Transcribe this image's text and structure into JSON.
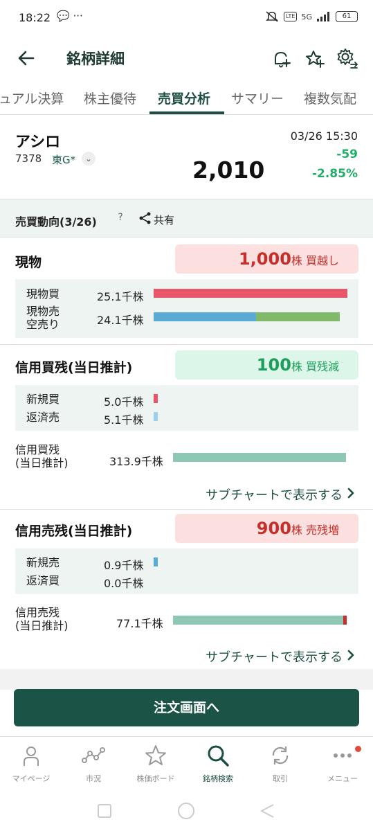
{
  "status_bar": {
    "time": "18:22",
    "left_icons": "💬 ···",
    "network": "5G",
    "battery": "61"
  },
  "header": {
    "title": "銘柄詳細"
  },
  "tabs": [
    {
      "label": "ュアル決算"
    },
    {
      "label": "株主優待"
    },
    {
      "label": "売買分析",
      "active": true
    },
    {
      "label": "サマリー"
    },
    {
      "label": "複数気配"
    }
  ],
  "stock": {
    "name": "アシロ",
    "code": "7378",
    "market": "東G*",
    "price": "2,010",
    "datetime": "03/26 15:30",
    "change": "-59",
    "change_pct": "-2.85%"
  },
  "section": {
    "title": "売買動向(3/26)",
    "help": "?",
    "share_label": "共有"
  },
  "spot": {
    "title": "現物",
    "badge_num": "1,000",
    "badge_unit": "株 買越し",
    "rows": [
      {
        "label": "現物買",
        "value": "25.1千株"
      },
      {
        "label": "現物売\n空売り",
        "value": "24.1千株"
      }
    ],
    "buy_fraction": 1.0,
    "sell_fraction": 0.96,
    "short_share": 0.45
  },
  "margin_buy": {
    "title": "信用買残(当日推計)",
    "badge_num": "100",
    "badge_unit": "株 買残減",
    "rows": [
      {
        "label": "新規買",
        "value": "5.0千株"
      },
      {
        "label": "返済売",
        "value": "5.1千株"
      }
    ],
    "balance_label": "信用買残\n(当日推計)",
    "balance_value": "313.9千株",
    "sub_chart_link": "サブチャートで表示する"
  },
  "margin_sell": {
    "title": "信用売残(当日推計)",
    "badge_num": "900",
    "badge_unit": "株 売残増",
    "rows": [
      {
        "label": "新規売",
        "value": "0.9千株"
      },
      {
        "label": "返済買",
        "value": "0.0千株"
      }
    ],
    "balance_label": "信用売残\n(当日推計)",
    "balance_value": "77.1千株",
    "sub_chart_link": "サブチャートで表示する"
  },
  "order_button": {
    "label": "注文画面へ"
  },
  "bottom_nav": [
    {
      "label": "マイページ",
      "icon": "person-icon"
    },
    {
      "label": "市況",
      "icon": "market-icon"
    },
    {
      "label": "株価ボード",
      "icon": "star-icon"
    },
    {
      "label": "銘柄検索",
      "icon": "search-icon",
      "active": true
    },
    {
      "label": "取引",
      "icon": "trade-icon"
    },
    {
      "label": "メニュー",
      "icon": "menu-icon"
    }
  ],
  "colors": {
    "accent": "#1d4d42",
    "buy_bar": "#e8566a",
    "sell_bar": "#5aaad6",
    "short_bar": "#80b96a",
    "balance_bar": "#8fc7b5",
    "down": "#22ad6a"
  }
}
